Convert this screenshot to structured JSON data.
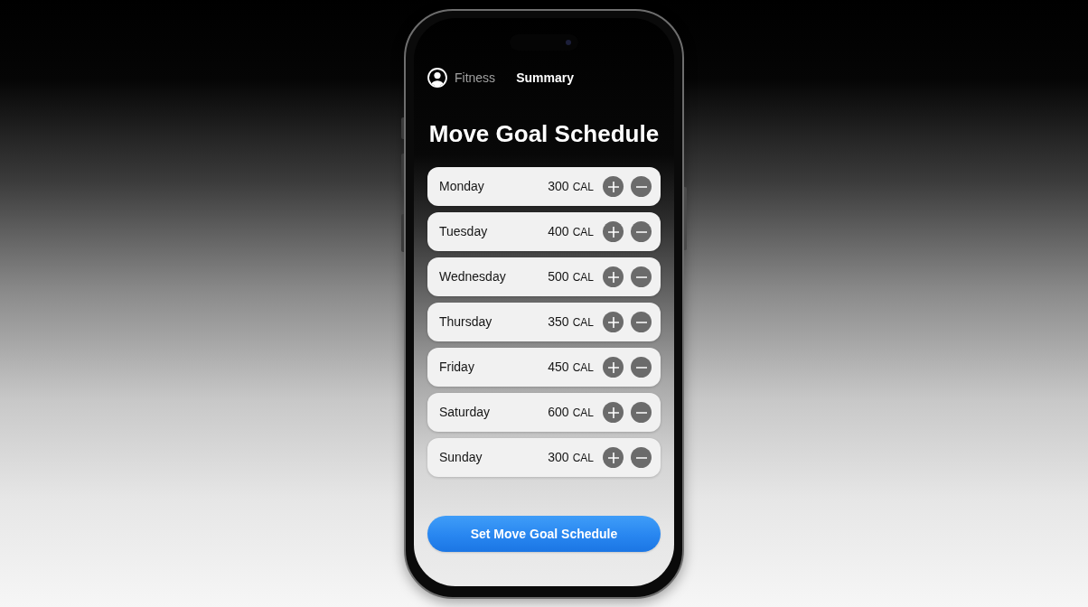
{
  "header": {
    "app_label": "Fitness",
    "title": "Summary"
  },
  "heading": "Move Goal Schedule",
  "days": [
    {
      "day": "Monday",
      "value": "300",
      "unit": "CAL"
    },
    {
      "day": "Tuesday",
      "value": "400",
      "unit": "CAL"
    },
    {
      "day": "Wednesday",
      "value": "500",
      "unit": "CAL"
    },
    {
      "day": "Thursday",
      "value": "350",
      "unit": "CAL"
    },
    {
      "day": "Friday",
      "value": "450",
      "unit": "CAL"
    },
    {
      "day": "Saturday",
      "value": "600",
      "unit": "CAL"
    },
    {
      "day": "Sunday",
      "value": "300",
      "unit": "CAL"
    }
  ],
  "primary_button": {
    "label": "Set Move Goal Schedule"
  }
}
